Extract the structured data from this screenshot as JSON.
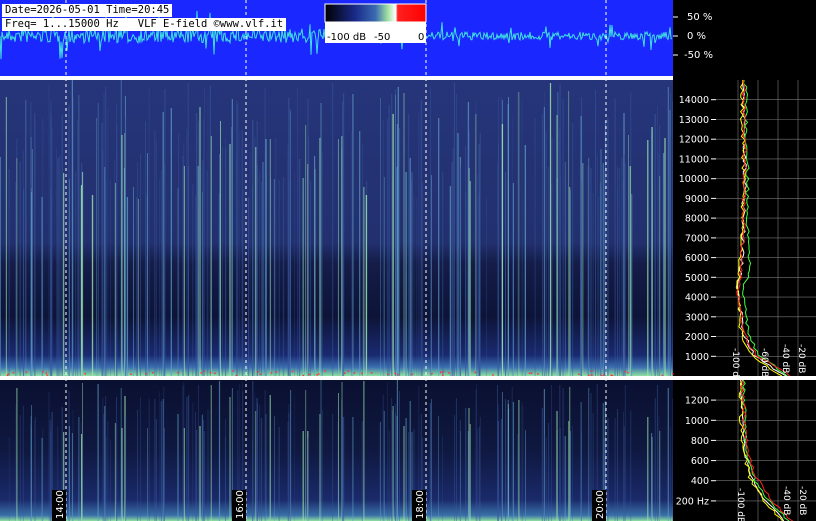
{
  "header": {
    "date_time": "Date=2026-05-01 Time=20:45",
    "freq_info": "Freq= 1...15000 Hz   VLF E-field ©www.vlf.it"
  },
  "colorbar": {
    "labels": [
      "-100 dB",
      "-50",
      "0"
    ],
    "colors": [
      "#000000",
      "#1a2a8a",
      "#3a6ab0",
      "#ffffff",
      "#ff0000"
    ]
  },
  "waveform": {
    "ticks": [
      "50 %",
      "0 %",
      "-50 %"
    ],
    "background": "#1a28ff",
    "trace_color": "#40e0e0"
  },
  "spectrogram": {
    "time_labels": [
      "14:00",
      "16:00",
      "18:00",
      "20:00"
    ],
    "colors": {
      "background": "#1c2a6a",
      "line": "#6fd3a0",
      "dark_band": "#0a1230"
    }
  },
  "chart_data": [
    {
      "type": "heatmap",
      "title": "",
      "xlabel": "",
      "ylabel": "",
      "x_ticks": [
        "14:00",
        "16:00",
        "18:00",
        "20:00"
      ],
      "y_ticks": [
        "1000",
        "2000",
        "3000",
        "4000",
        "5000",
        "6000",
        "7000",
        "8000",
        "9000",
        "10000",
        "11000",
        "12000",
        "13000",
        "14000"
      ],
      "ylim": [
        0,
        15000
      ],
      "value_range_db": [
        -100,
        0
      ]
    },
    {
      "type": "heatmap",
      "title": "",
      "x_ticks": [
        "14:00",
        "16:00",
        "18:00",
        "20:00"
      ],
      "y_ticks": [
        "200 Hz",
        "400",
        "600",
        "800",
        "1000",
        "1200"
      ],
      "ylim": [
        0,
        1400
      ],
      "value_range_db": [
        -100,
        0
      ]
    },
    {
      "type": "line",
      "title": "",
      "x_ticks": [
        "-100 dB",
        "-60 dB",
        "-40 dB",
        "-20 dB"
      ],
      "y_ticks": [
        "1000",
        "2000",
        "3000",
        "4000",
        "5000",
        "6000",
        "7000",
        "8000",
        "9000",
        "10000",
        "11000",
        "12000",
        "13000",
        "14000"
      ],
      "ylim": [
        0,
        15000
      ],
      "series": [
        {
          "color": "#ffffff",
          "values_db": [
            -45,
            -70,
            -78,
            -80,
            -82,
            -80,
            -79,
            -78,
            -78,
            -77,
            -77,
            -77,
            -78,
            -78,
            -78
          ]
        },
        {
          "color": "#ffff00",
          "values_db": [
            -48,
            -72,
            -80,
            -81,
            -83,
            -81,
            -80,
            -79,
            -79,
            -78,
            -78,
            -78,
            -79,
            -79,
            -79
          ]
        },
        {
          "color": "#40ff40",
          "values_db": [
            -42,
            -66,
            -74,
            -76,
            -79,
            -72,
            -74,
            -75,
            -75,
            -75,
            -75,
            -76,
            -76,
            -76,
            -77
          ]
        },
        {
          "color": "#ff2020",
          "values_db": [
            -40,
            -68,
            -78,
            -80,
            -82,
            -80,
            -79,
            -78,
            -78,
            -77,
            -77,
            -77,
            -78,
            -78,
            -78
          ]
        }
      ]
    },
    {
      "type": "line",
      "title": "",
      "x_ticks": [
        "-100 dB",
        "-40 dB",
        "-20 dB"
      ],
      "y_ticks": [
        "200 Hz",
        "400",
        "600",
        "800",
        "1000",
        "1200"
      ],
      "ylim": [
        0,
        1400
      ],
      "series": [
        {
          "color": "#ffffff",
          "values_db": [
            -45,
            -60,
            -70,
            -75,
            -78,
            -78,
            -79,
            -79
          ]
        },
        {
          "color": "#ffff00",
          "values_db": [
            -47,
            -62,
            -72,
            -76,
            -79,
            -80,
            -80,
            -80
          ]
        },
        {
          "color": "#40ff40",
          "values_db": [
            -42,
            -58,
            -69,
            -74,
            -77,
            -77,
            -78,
            -78
          ]
        },
        {
          "color": "#ff2020",
          "values_db": [
            -40,
            -55,
            -66,
            -73,
            -76,
            -77,
            -78,
            -79
          ]
        }
      ]
    }
  ]
}
